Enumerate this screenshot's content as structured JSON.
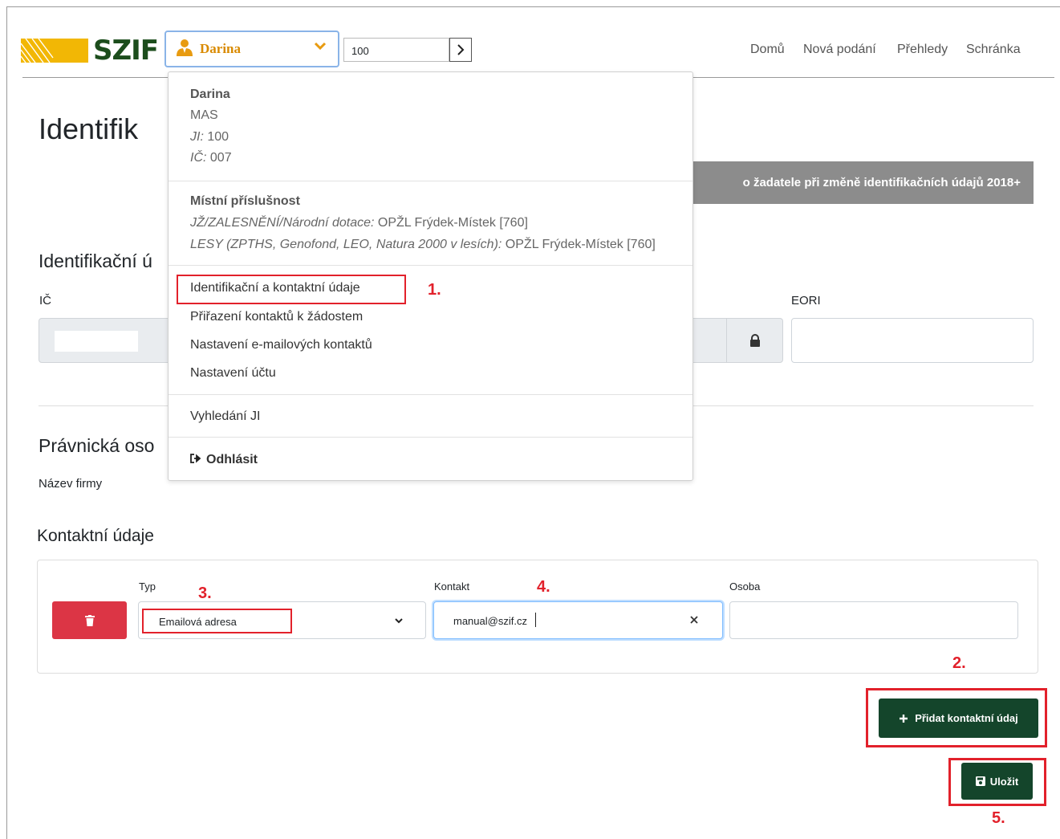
{
  "header": {
    "logo_text": "SZIF",
    "user_name": "Darina",
    "ji_value": "100",
    "nav": [
      "Domů",
      "Nová podání",
      "Přehledy",
      "Schránka"
    ]
  },
  "page": {
    "title": "Identifik",
    "top_button": "o žadatele při změně identifikačních údajů 2018+",
    "ident_section": "Identifikační ú",
    "ic_label": "IČ",
    "eori_label": "EORI",
    "legal_section": "Právnická oso",
    "company_label": "Název firmy"
  },
  "user_menu": {
    "name": "Darina",
    "org": "MAS",
    "ji_label": "JI:",
    "ji_value": "100",
    "ic_label": "IČ:",
    "ic_value": "007",
    "locality_title": "Místní příslušnost",
    "locality_1_label": "JŽ/ZALESNĚNÍ/Národní dotace:",
    "locality_1_value": "OPŽL Frýdek-Místek [760]",
    "locality_2_label": "LESY (ZPTHS, Genofond, LEO, Natura 2000 v lesích):",
    "locality_2_value": "OPŽL Frýdek-Místek [760]",
    "items": [
      "Identifikační a kontaktní údaje",
      "Přiřazení kontaktů k žádostem",
      "Nastavení e-mailových kontaktů",
      "Nastavení účtu"
    ],
    "search": "Vyhledání JI",
    "logout": "Odhlásit"
  },
  "contacts": {
    "title": "Kontaktní údaje",
    "type_label": "Typ",
    "type_value": "Emailová adresa",
    "contact_label": "Kontakt",
    "contact_value": "manual@szif.cz",
    "person_label": "Osoba",
    "person_value": "",
    "add_button": "Přidat kontaktní údaj",
    "save_button": "Uložit"
  },
  "annotations": {
    "step1": "1.",
    "step2": "2.",
    "step3": "3.",
    "step4": "4.",
    "step5": "5."
  },
  "colors": {
    "brand_green": "#14452b",
    "logo_yellow": "#f2b705",
    "delete_red": "#dc3545",
    "annotation_red": "#e2212b",
    "user_orange": "#d98a00"
  }
}
